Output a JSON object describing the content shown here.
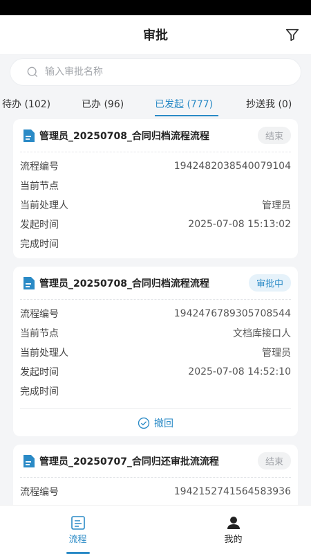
{
  "header": {
    "title": "审批"
  },
  "search": {
    "placeholder": "输入审批名称"
  },
  "tabs": [
    {
      "label": "待办 (102)"
    },
    {
      "label": "已办 (96)"
    },
    {
      "label": "已发起 (777)"
    },
    {
      "label": "抄送我 (0)"
    }
  ],
  "field_labels": {
    "process_no": "流程编号",
    "current_node": "当前节点",
    "current_handler": "当前处理人",
    "start_time": "发起时间",
    "finish_time": "完成时间"
  },
  "cards": [
    {
      "title": "管理员_20250708_合同归档流程流程",
      "status": "结束",
      "process_no": "1942482038540079104",
      "current_node": "",
      "current_handler": "管理员",
      "start_time": "2025-07-08 15:13:02",
      "finish_time": ""
    },
    {
      "title": "管理员_20250708_合同归档流程流程",
      "status": "审批中",
      "process_no": "1942476789305708544",
      "current_node": "文档库接口人",
      "current_handler": "管理员",
      "start_time": "2025-07-08 14:52:10",
      "finish_time": "",
      "action_label": "撤回"
    },
    {
      "title": "管理员_20250707_合同归还审批流流程",
      "status": "结束",
      "process_no": "1942152741564583936"
    }
  ],
  "tabbar": [
    {
      "label": "流程"
    },
    {
      "label": "我的"
    }
  ],
  "colors": {
    "accent": "#2a8ac6",
    "background": "#f4f5f7"
  }
}
